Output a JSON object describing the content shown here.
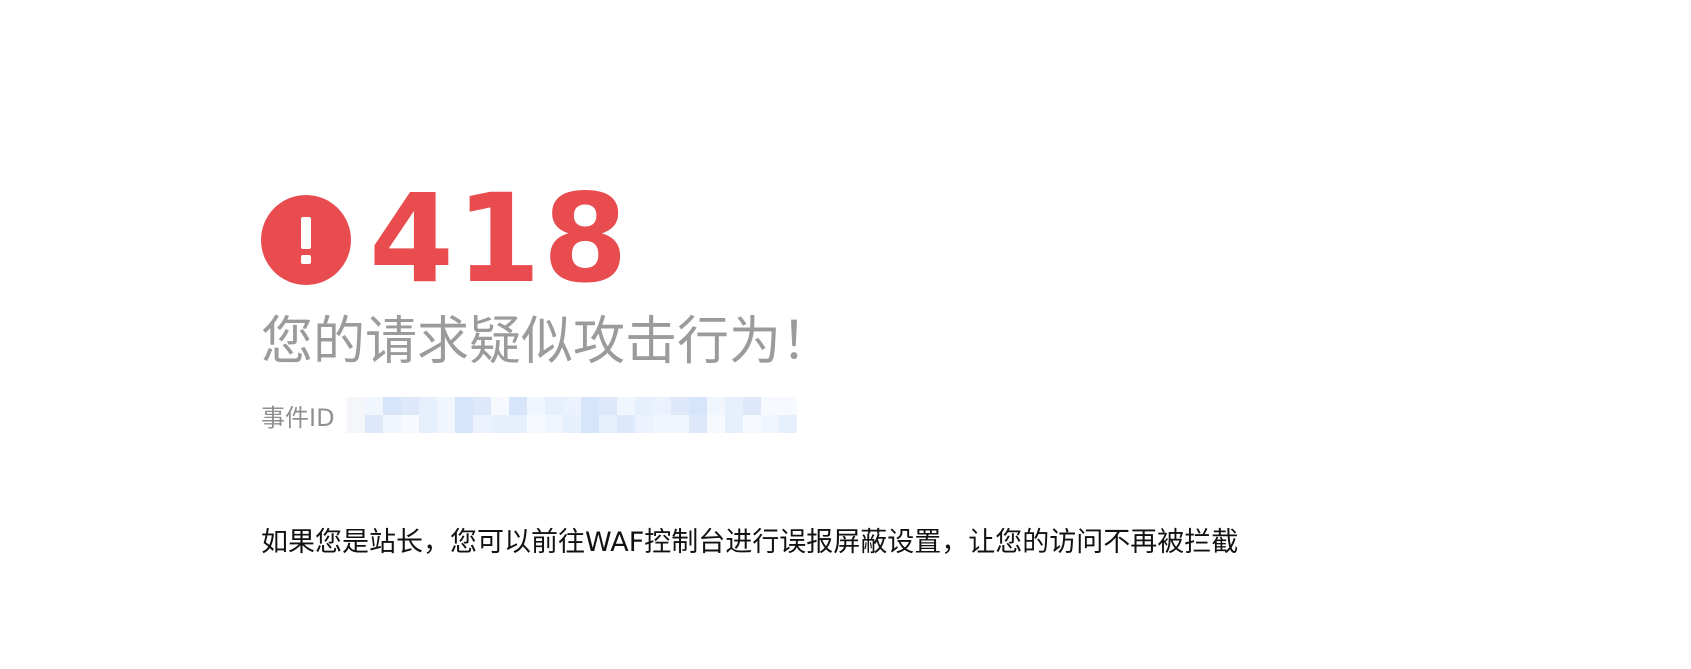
{
  "error": {
    "code": "418",
    "title": "您的请求疑似攻击行为！",
    "event_id_label": "事件ID",
    "message": "如果您是站长，您可以前往WAF控制台进行误报屏蔽设置，让您的访问不再被拦截"
  },
  "icons": {
    "alert": "exclamation-circle-icon"
  },
  "colors": {
    "accent": "#e84c4f",
    "title_gray": "#9b9b9b",
    "label_gray": "#8f8f8f",
    "text": "#111111",
    "redacted_blue": "#dbe8fb"
  }
}
